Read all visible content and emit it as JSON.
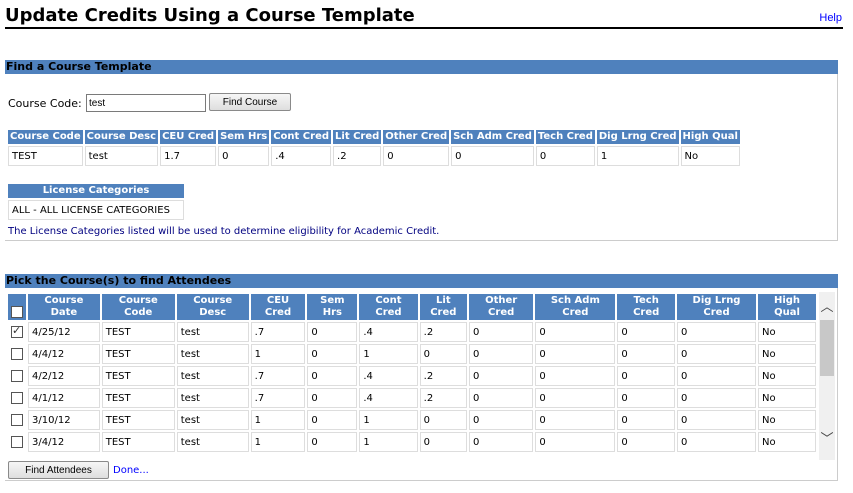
{
  "page": {
    "title": "Update Credits Using a Course Template",
    "help": "Help"
  },
  "find": {
    "heading": "Find a Course Template",
    "course_code_label": "Course Code:",
    "course_code_value": "test",
    "find_button": "Find Course",
    "table_headers": [
      "Course Code",
      "Course Desc",
      "CEU Cred",
      "Sem Hrs",
      "Cont Cred",
      "Lit Cred",
      "Other Cred",
      "Sch Adm Cred",
      "Tech Cred",
      "Dig Lrng Cred",
      "High Qual"
    ],
    "table_row": [
      "TEST",
      "test",
      "1.7",
      "0",
      ".4",
      ".2",
      "0",
      "0",
      "0",
      "1",
      "No"
    ],
    "license_header": "License Categories",
    "license_value": "ALL - ALL LICENSE CATEGORIES",
    "note": "The License Categories listed will be used to determine eligibility for Academic Credit."
  },
  "pick": {
    "heading": "Pick the Course(s) to find Attendees",
    "table_headers": [
      "Course Date",
      "Course Code",
      "Course Desc",
      "CEU Cred",
      "Sem Hrs",
      "Cont Cred",
      "Lit Cred",
      "Other Cred",
      "Sch Adm Cred",
      "Tech Cred",
      "Dig Lrng Cred",
      "High Qual"
    ],
    "rows": [
      {
        "checked": true,
        "cells": [
          "4/25/12",
          "TEST",
          "test",
          ".7",
          "0",
          ".4",
          ".2",
          "0",
          "0",
          "0",
          "0",
          "No"
        ]
      },
      {
        "checked": false,
        "cells": [
          "4/4/12",
          "TEST",
          "test",
          "1",
          "0",
          "1",
          "0",
          "0",
          "0",
          "0",
          "0",
          "No"
        ]
      },
      {
        "checked": false,
        "cells": [
          "4/2/12",
          "TEST",
          "test",
          ".7",
          "0",
          ".4",
          ".2",
          "0",
          "0",
          "0",
          "0",
          "No"
        ]
      },
      {
        "checked": false,
        "cells": [
          "4/1/12",
          "TEST",
          "test",
          ".7",
          "0",
          ".4",
          ".2",
          "0",
          "0",
          "0",
          "0",
          "No"
        ]
      },
      {
        "checked": false,
        "cells": [
          "3/10/12",
          "TEST",
          "test",
          "1",
          "0",
          "1",
          "0",
          "0",
          "0",
          "0",
          "0",
          "No"
        ]
      },
      {
        "checked": false,
        "cells": [
          "3/4/12",
          "TEST",
          "test",
          "1",
          "0",
          "1",
          "0",
          "0",
          "0",
          "0",
          "0",
          "No"
        ]
      }
    ],
    "find_attendees_button": "Find Attendees",
    "done_link": "Done..."
  },
  "icons": {
    "scroll_up": "chevron-up-icon",
    "scroll_down": "chevron-down-icon",
    "check": "checkmark-icon"
  }
}
